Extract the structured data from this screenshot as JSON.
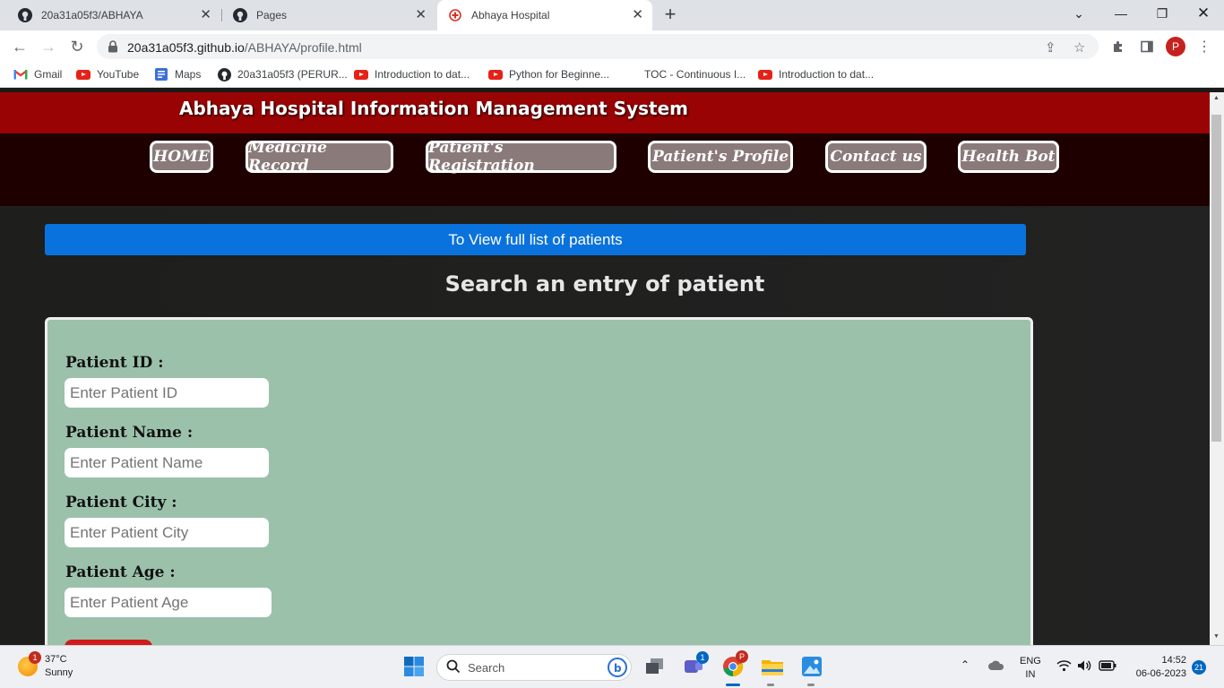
{
  "browser": {
    "tabs": [
      {
        "title": "20a31a05f3/ABHAYA",
        "icon": "github-icon"
      },
      {
        "title": "Pages",
        "icon": "github-icon"
      },
      {
        "title": "Abhaya Hospital",
        "icon": "hospital-cross-icon",
        "active": true
      }
    ],
    "url_host": "20a31a05f3.github.io",
    "url_path": "/ABHAYA/profile.html",
    "profile_initial": "P",
    "bookmarks": [
      {
        "label": "Gmail",
        "icon": "gmail-icon"
      },
      {
        "label": "YouTube",
        "icon": "youtube-icon"
      },
      {
        "label": "Maps",
        "icon": "maps-icon"
      },
      {
        "label": "20a31a05f3 (PERUR...",
        "icon": "github-icon"
      },
      {
        "label": "Introduction to dat...",
        "icon": "youtube-icon"
      },
      {
        "label": "Python for Beginne...",
        "icon": "youtube-icon"
      },
      {
        "label": "TOC - Continuous I...",
        "icon": "none"
      },
      {
        "label": "Introduction to dat...",
        "icon": "youtube-icon"
      }
    ]
  },
  "site": {
    "title": "Abhaya Hospital Information Management System",
    "nav": [
      "HOME",
      "Medicine Record",
      "Patient's Registration",
      "Patient's Profile",
      "Contact us",
      "Health Bot"
    ],
    "view_list_button": "To View full list of patients",
    "search_heading": "Search an entry of patient",
    "form": {
      "fields": [
        {
          "label": "Patient ID :",
          "placeholder": "Enter Patient ID"
        },
        {
          "label": "Patient Name :",
          "placeholder": "Enter Patient Name"
        },
        {
          "label": "Patient City :",
          "placeholder": "Enter Patient City"
        },
        {
          "label": "Patient Age :",
          "placeholder": "Enter Patient Age"
        }
      ]
    },
    "colors": {
      "title_bar": "#990303",
      "nav_bg": "#1e0000",
      "view_button": "#0a72dc",
      "form_bg": "#9bc1ab",
      "submit": "#d11a1a"
    }
  },
  "taskbar": {
    "weather_temp": "37°C",
    "weather_desc": "Sunny",
    "weather_badge": "1",
    "search_placeholder": "Search",
    "teams_badge": "1",
    "chrome_profile_badge": "P",
    "lang_top": "ENG",
    "lang_bottom": "IN",
    "time": "14:52",
    "date": "06-06-2023",
    "notifications": "21"
  }
}
